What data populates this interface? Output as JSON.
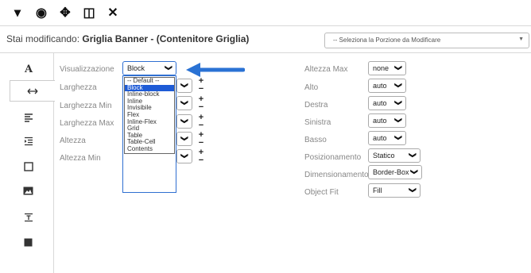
{
  "toolbar": {
    "buttons": [
      {
        "name": "dropdown-caret-icon",
        "glyph": "▾"
      },
      {
        "name": "eye-icon",
        "glyph": "◉"
      },
      {
        "name": "move-icon",
        "glyph": "✥"
      },
      {
        "name": "columns-icon",
        "glyph": "◫"
      },
      {
        "name": "close-icon",
        "glyph": "✕"
      }
    ]
  },
  "editbar": {
    "prefix": "Stai modificando: ",
    "target": "Griglia Banner - (Contenitore Griglia)",
    "portion_placeholder": "-- Seleziona la Porzione da Modificare"
  },
  "sidenav": [
    "text-A-icon",
    "arrows-horizontal-icon",
    "align-left-icon",
    "indent-icon",
    "box-icon",
    "image-icon",
    "text-wrap-icon",
    "square-fill-icon"
  ],
  "left_fields": {
    "visualizzazione": {
      "label": "Visualizzazione",
      "value": "Block"
    },
    "larghezza": "Larghezza",
    "larghezza_min": "Larghezza Min",
    "larghezza_max": "Larghezza Max",
    "altezza": "Altezza",
    "altezza_min": "Altezza Min"
  },
  "display_options": [
    "-- Default --",
    "Block",
    "Inline-block",
    "Inline",
    "Invisibile",
    "Flex",
    "Inline-Flex",
    "Grid",
    "Table",
    "Table-Cell",
    "Contents"
  ],
  "display_selected_index": 1,
  "right_fields": {
    "altezza_max": {
      "label": "Altezza Max",
      "value": "none"
    },
    "alto": {
      "label": "Alto",
      "value": "auto"
    },
    "destra": {
      "label": "Destra",
      "value": "auto"
    },
    "sinistra": {
      "label": "Sinistra",
      "value": "auto"
    },
    "basso": {
      "label": "Basso",
      "value": "auto"
    },
    "posizionamento": {
      "label": "Posizionamento",
      "value": "Statico"
    },
    "dimensionamento": {
      "label": "Dimensionamento",
      "value": "Border-Box"
    },
    "object_fit": {
      "label": "Object Fit",
      "value": "Fill"
    }
  },
  "pm": {
    "plus": "+",
    "minus": "−"
  },
  "chevron": "⌄",
  "accent": "#2f6fd1",
  "arrow_color": "#2a72d4"
}
